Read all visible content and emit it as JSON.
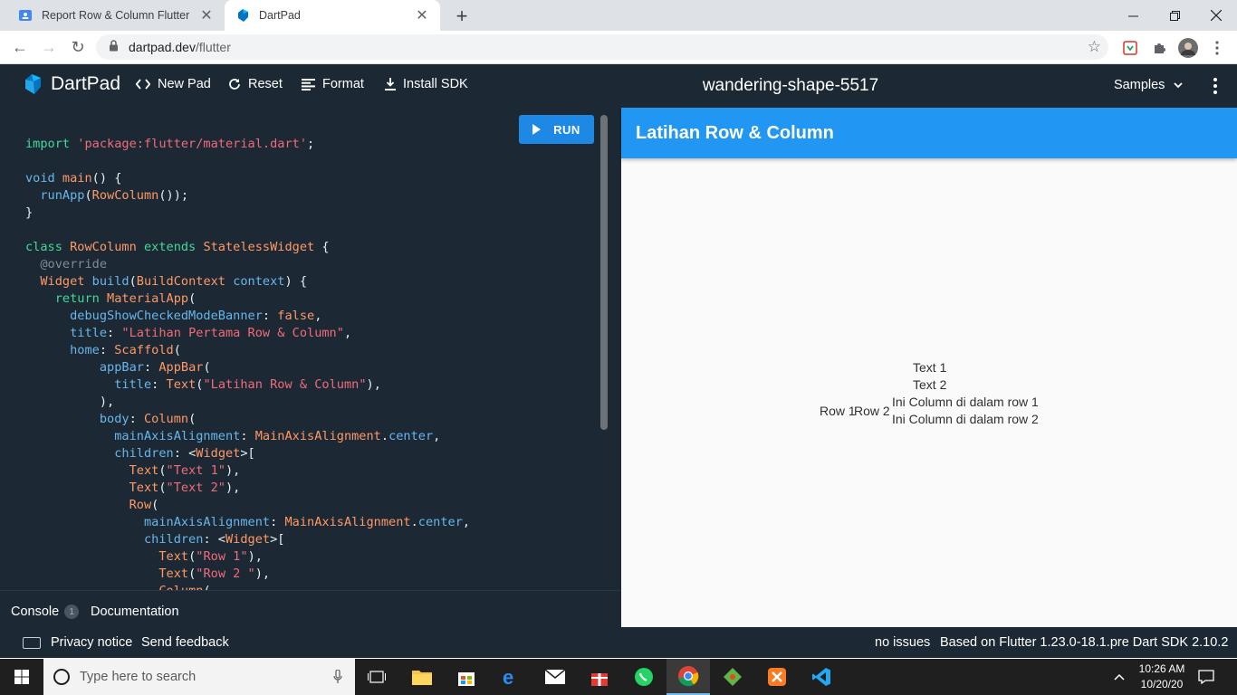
{
  "browser": {
    "tabs": [
      {
        "title": "Report Row & Column Flutter",
        "active": false
      },
      {
        "title": "DartPad",
        "active": true
      }
    ],
    "url_host": "dartpad.dev",
    "url_path": "/flutter"
  },
  "dartpad": {
    "logo": "DartPad",
    "buttons": {
      "new_pad": "New Pad",
      "reset": "Reset",
      "format": "Format",
      "install_sdk": "Install SDK"
    },
    "pad_name": "wandering-shape-5517",
    "samples": "Samples",
    "run": "RUN"
  },
  "editor": {
    "lines": [
      [
        [
          "k",
          "import "
        ],
        [
          "s",
          "'package:flutter/material.dart'"
        ],
        [
          "",
          "; "
        ]
      ],
      [],
      [
        [
          "p",
          "void "
        ],
        [
          "t",
          "main"
        ],
        [
          "",
          "() {"
        ]
      ],
      [
        [
          "",
          "  "
        ],
        [
          "p",
          "runApp"
        ],
        [
          "",
          "("
        ],
        [
          "t",
          "RowColumn"
        ],
        [
          "",
          "());"
        ]
      ],
      [
        [
          "",
          "}"
        ]
      ],
      [],
      [
        [
          "k",
          "class "
        ],
        [
          "t",
          "RowColumn "
        ],
        [
          "k",
          "extends "
        ],
        [
          "t",
          "StatelessWidget "
        ],
        [
          "",
          "{"
        ]
      ],
      [
        [
          "c",
          "  @override"
        ]
      ],
      [
        [
          "",
          "  "
        ],
        [
          "t",
          "Widget "
        ],
        [
          "p",
          "build"
        ],
        [
          "",
          "("
        ],
        [
          "t",
          "BuildContext "
        ],
        [
          "p",
          "context"
        ],
        [
          "",
          ") {"
        ]
      ],
      [
        [
          "",
          "    "
        ],
        [
          "k",
          "return "
        ],
        [
          "t",
          "MaterialApp"
        ],
        [
          "",
          "("
        ]
      ],
      [
        [
          "",
          "      "
        ],
        [
          "p",
          "debugShowCheckedModeBanner"
        ],
        [
          "",
          ": "
        ],
        [
          "t",
          "false"
        ],
        [
          "",
          ","
        ]
      ],
      [
        [
          "",
          "      "
        ],
        [
          "p",
          "title"
        ],
        [
          "",
          ": "
        ],
        [
          "s",
          "\"Latihan Pertama Row & Column\""
        ],
        [
          "",
          ","
        ]
      ],
      [
        [
          "",
          "      "
        ],
        [
          "p",
          "home"
        ],
        [
          "",
          ": "
        ],
        [
          "t",
          "Scaffold"
        ],
        [
          "",
          "("
        ]
      ],
      [
        [
          "",
          "          "
        ],
        [
          "p",
          "appBar"
        ],
        [
          "",
          ": "
        ],
        [
          "t",
          "AppBar"
        ],
        [
          "",
          "("
        ]
      ],
      [
        [
          "",
          "            "
        ],
        [
          "p",
          "title"
        ],
        [
          "",
          ": "
        ],
        [
          "t",
          "Text"
        ],
        [
          "",
          "("
        ],
        [
          "s",
          "\"Latihan Row & Column\""
        ],
        [
          "",
          "),"
        ]
      ],
      [
        [
          "",
          "          ),"
        ]
      ],
      [
        [
          "",
          "          "
        ],
        [
          "p",
          "body"
        ],
        [
          "",
          ": "
        ],
        [
          "t",
          "Column"
        ],
        [
          "",
          "("
        ]
      ],
      [
        [
          "",
          "            "
        ],
        [
          "p",
          "mainAxisAlignment"
        ],
        [
          "",
          ": "
        ],
        [
          "t",
          "MainAxisAlignment"
        ],
        [
          "",
          "."
        ],
        [
          "p",
          "center"
        ],
        [
          "",
          ","
        ]
      ],
      [
        [
          "",
          "            "
        ],
        [
          "p",
          "children"
        ],
        [
          "",
          ": <"
        ],
        [
          "t",
          "Widget"
        ],
        [
          "",
          ">["
        ]
      ],
      [
        [
          "",
          "              "
        ],
        [
          "t",
          "Text"
        ],
        [
          "",
          "("
        ],
        [
          "s",
          "\"Text 1\""
        ],
        [
          "",
          "),"
        ]
      ],
      [
        [
          "",
          "              "
        ],
        [
          "t",
          "Text"
        ],
        [
          "",
          "("
        ],
        [
          "s",
          "\"Text 2\""
        ],
        [
          "",
          "),"
        ]
      ],
      [
        [
          "",
          "              "
        ],
        [
          "t",
          "Row"
        ],
        [
          "",
          "("
        ]
      ],
      [
        [
          "",
          "                "
        ],
        [
          "p",
          "mainAxisAlignment"
        ],
        [
          "",
          ": "
        ],
        [
          "t",
          "MainAxisAlignment"
        ],
        [
          "",
          "."
        ],
        [
          "p",
          "center"
        ],
        [
          "",
          ","
        ]
      ],
      [
        [
          "",
          "                "
        ],
        [
          "p",
          "children"
        ],
        [
          "",
          ": <"
        ],
        [
          "t",
          "Widget"
        ],
        [
          "",
          ">["
        ]
      ],
      [
        [
          "",
          "                  "
        ],
        [
          "t",
          "Text"
        ],
        [
          "",
          "("
        ],
        [
          "s",
          "\"Row 1\""
        ],
        [
          "",
          "),"
        ]
      ],
      [
        [
          "",
          "                  "
        ],
        [
          "t",
          "Text"
        ],
        [
          "",
          "("
        ],
        [
          "s",
          "\"Row 2 \""
        ],
        [
          "",
          "),"
        ]
      ],
      [
        [
          "",
          "                  "
        ],
        [
          "t",
          "Column"
        ],
        [
          "",
          "("
        ]
      ]
    ]
  },
  "console": {
    "label": "Console",
    "badge": "1",
    "docs": "Documentation"
  },
  "preview": {
    "appbar_title": "Latihan Row & Column",
    "text1": "Text 1",
    "text2": "Text 2",
    "row1": "Row 1",
    "row2": "Row 2",
    "col1": "Ini Column di dalam row 1",
    "col2": "Ini Column di dalam row 2"
  },
  "footer": {
    "privacy": "Privacy notice",
    "feedback": "Send feedback",
    "issues": "no issues",
    "version": "Based on Flutter 1.23.0-18.1.pre Dart SDK 2.10.2"
  },
  "taskbar": {
    "search_placeholder": "Type here to search",
    "time": "10:26 AM",
    "date": "10/20/20"
  },
  "colors": {
    "dartpad_bg": "#1c2834",
    "appbar": "#2196f3",
    "run": "#1e88e5"
  }
}
